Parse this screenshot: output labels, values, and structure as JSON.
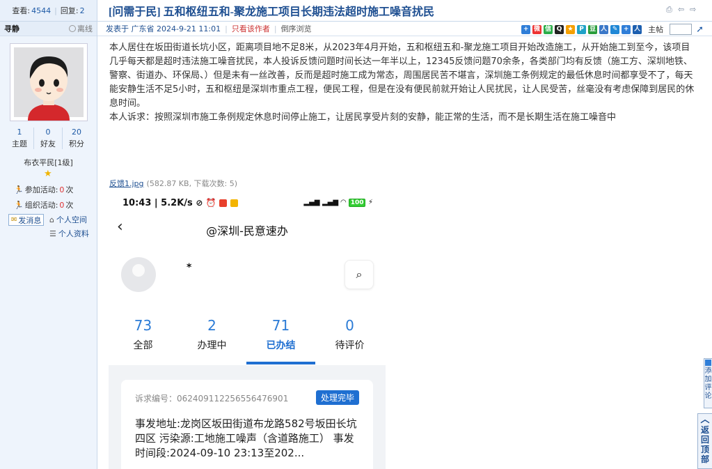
{
  "topbar": {
    "views_label": "查看:",
    "views_value": "4544",
    "replies_label": "回复:",
    "replies_value": "2",
    "category": "[问需于民]",
    "title": "五和枢纽五和-聚龙施工项目长期违法超时施工噪音扰民"
  },
  "author": {
    "name": "寻静",
    "status": "离线",
    "stats": [
      {
        "value": "1",
        "label": "主题"
      },
      {
        "value": "0",
        "label": "好友"
      },
      {
        "value": "20",
        "label": "积分"
      }
    ],
    "rank": "布衣平民[1级]",
    "activity_join_label": "参加活动:",
    "activity_join_count": "0",
    "activity_org_label": "组织活动:",
    "activity_org_count": "0",
    "times_unit": "次",
    "send_message": "发消息",
    "personal_space": "个人空间",
    "personal_profile": "个人资料"
  },
  "meta": {
    "posted": "发表于 广东省 2024-9-21 11:01",
    "only_author": "只看该作者",
    "reverse": "倒序浏览",
    "floor_label": "主帖"
  },
  "post": {
    "para1": "本人居住在坂田街道长坑小区，距离项目地不足8米，从2023年4月开始，五和枢纽五和-聚龙施工项目开始改造施工，从开始施工到至今，该项目几乎每天都是超时违法施工噪音扰民，本人投诉反馈问题时间长达一年半以上，12345反馈问题70余条，各类部门均有反馈（施工方、深圳地铁、警察、街道办、环保局、）但是未有一丝改善，反而是超时施工成为常态，周围居民苦不堪言，深圳施工条例规定的最低休息时间都享受不了，每天能安静生活不足5小时，五和枢纽是深圳市重点工程，便民工程，但是在没有便民前就开始让人民扰民，让人民受苦，丝毫没有考虑保障到居民的休息时间。",
    "para2": "本人诉求：按照深圳市施工条例规定休息时间停止施工，让居民享受片刻的安静，能正常的生活，而不是长期生活在施工噪音中"
  },
  "attachment": {
    "filename": "反馈1.jpg",
    "info": "(582.87 KB, 下载次数: 5)"
  },
  "phone": {
    "status_left": "10:43 | 5.2K/s",
    "status_right": "100",
    "nav_title": "@深圳-民意速办",
    "nickname": "*",
    "tabs": [
      {
        "count": "73",
        "label": "全部"
      },
      {
        "count": "2",
        "label": "办理中"
      },
      {
        "count": "71",
        "label": "已办结"
      },
      {
        "count": "0",
        "label": "待评价"
      }
    ],
    "card": {
      "code": "诉求编号：062409112256556476901",
      "badge": "处理完毕",
      "detail": "事发地址:龙岗区坂田街道布龙路582号坂田长坑四区 污染源:工地施工噪声（含道路施工） 事发时间段:2024-09-10 23:13至202..."
    }
  },
  "floats": {
    "feedback": "添加评论",
    "back_top": "返回顶部"
  }
}
